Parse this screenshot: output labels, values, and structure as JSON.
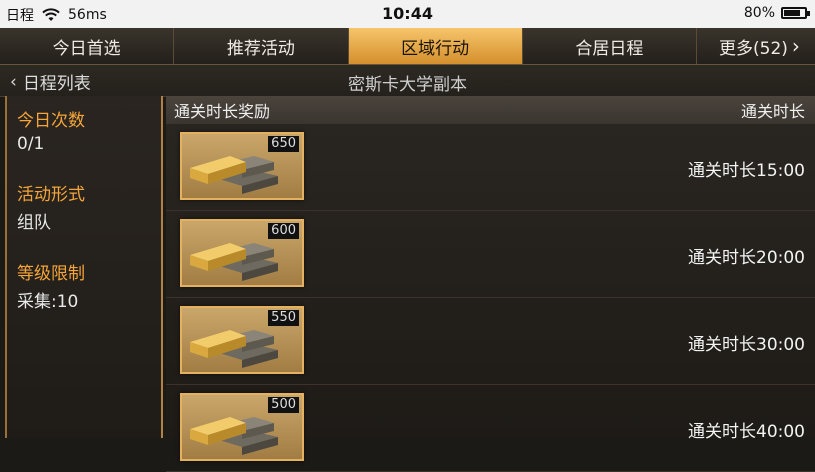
{
  "status_bar": {
    "carrier": "日程",
    "network": "56ms",
    "time": "10:44",
    "battery": "80%",
    "battery_level": 0.8
  },
  "tabs": [
    {
      "label": "今日首选",
      "active": false
    },
    {
      "label": "推荐活动",
      "active": false
    },
    {
      "label": "区域行动",
      "active": true
    },
    {
      "label": "合居日程",
      "active": false
    },
    {
      "label": "更多(52)",
      "active": false
    }
  ],
  "breadcrumb": {
    "back_label": "日程列表",
    "title": "密斯卡大学副本"
  },
  "info": {
    "daily_count_label": "今日次数",
    "daily_count_value": "0/1",
    "activity_form_label": "活动形式",
    "activity_form_value": "组队",
    "level_limit_label": "等级限制",
    "level_limit_value": "采集:10"
  },
  "rewards": {
    "col_reward": "通关时长奖励",
    "col_time": "通关时长",
    "rows": [
      {
        "count": "650",
        "time": "通关时长15:00"
      },
      {
        "count": "600",
        "time": "通关时长20:00"
      },
      {
        "count": "550",
        "time": "通关时长30:00"
      },
      {
        "count": "500",
        "time": "通关时长40:00"
      }
    ]
  },
  "colors": {
    "accent": "#f5a53a",
    "active_tab": "#e9ad50"
  }
}
